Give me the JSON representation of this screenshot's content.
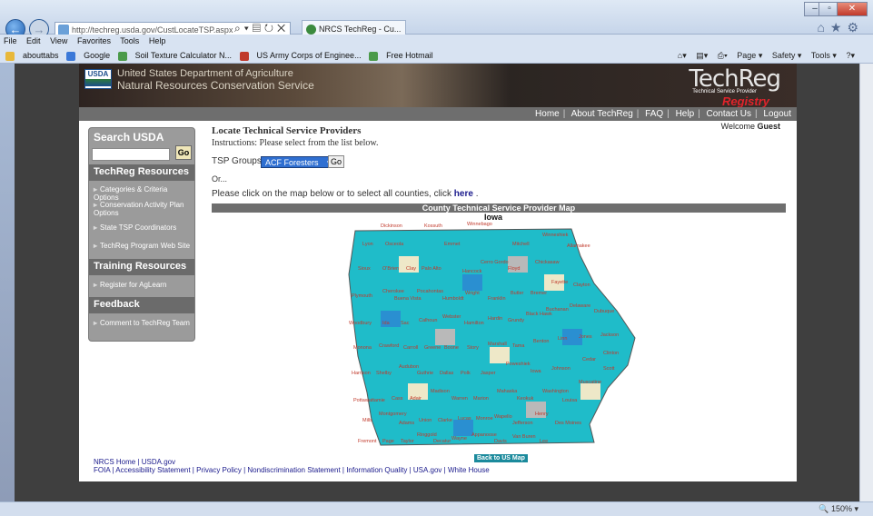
{
  "browser": {
    "url": "http://techreg.usda.gov/CustLocateTSP.aspx",
    "tab_title": "NRCS TechReg - Cu...",
    "menu": [
      "File",
      "Edit",
      "View",
      "Favorites",
      "Tools",
      "Help"
    ],
    "favorites": [
      "abouttabs",
      "Google",
      "Soil Texture Calculator N...",
      "US Army Corps of Enginee...",
      "Free Hotmail"
    ],
    "command_bar": [
      "Page ▾",
      "Safety ▾",
      "Tools ▾"
    ],
    "zoom": "150%"
  },
  "site": {
    "agency_line1": "United States Department of Agriculture",
    "agency_line2": "Natural Resources Conservation Service",
    "logo_usda": "USDA",
    "techreg_brand": "TechReg",
    "techreg_sub": "Technical Service Provider",
    "registry": "Registry",
    "nav": [
      "Home",
      "About TechReg",
      "FAQ",
      "Help",
      "Contact Us",
      "Logout"
    ],
    "welcome_prefix": "Welcome",
    "welcome_user": "Guest"
  },
  "sidebar": {
    "search_title": "Search USDA",
    "go": "Go",
    "resources_title": "TechReg Resources",
    "resources": [
      "Categories & Criteria Options",
      "Conservation Activity Plan Options",
      "State TSP Coordinators",
      "TechReg Program Web Site"
    ],
    "training_title": "Training Resources",
    "training": [
      "Register for AgLearn"
    ],
    "feedback_title": "Feedback",
    "feedback": [
      "Comment to TechReg Team"
    ]
  },
  "main": {
    "title": "Locate Technical Service Providers",
    "instructions": "Instructions: Please select from the list below.",
    "tsp_label": "TSP Groups:",
    "tsp_selected": "ACF Foresters",
    "go": "Go",
    "or": "Or...",
    "click_text": "Please click on the map below or to select all counties, click",
    "click_link": "here",
    "map_title": "County Technical Service Provider Map",
    "state": "Iowa",
    "back_link": "Back to US Map"
  },
  "footer": {
    "line1": "NRCS Home | USDA.gov",
    "line2": "FOIA | Accessibility Statement | Privacy Policy | Nondiscrimination Statement | Information Quality | USA.gov | White House"
  },
  "colors": {
    "teal": "#1fbcc9",
    "gray": "#b9b9b9",
    "beige": "#eee8c8",
    "blue": "#2a8fd1"
  }
}
